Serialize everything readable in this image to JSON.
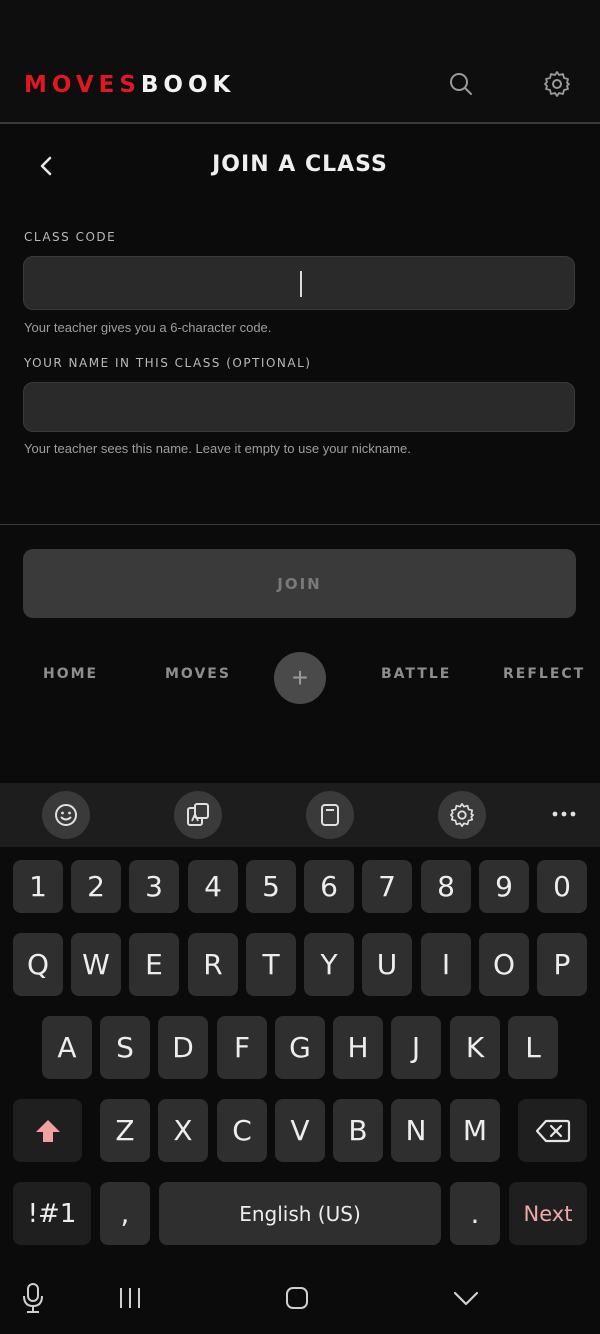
{
  "app": {
    "logo_red": "MOVES",
    "logo_white": "BOOK"
  },
  "page": {
    "title": "JOIN A CLASS"
  },
  "form": {
    "class_code_label": "CLASS CODE",
    "class_code_value": "",
    "class_code_hint": "Your teacher gives you a 6-character code.",
    "name_label": "YOUR NAME IN THIS CLASS (OPTIONAL)",
    "name_value": "",
    "name_hint": "Your teacher sees this name. Leave it empty to use your nickname.",
    "join_label": "JOIN"
  },
  "tabs": [
    "HOME",
    "MOVES",
    "BATTLE",
    "REFLECT"
  ],
  "fab_label": "+",
  "keyboard": {
    "row_numbers": [
      "1",
      "2",
      "3",
      "4",
      "5",
      "6",
      "7",
      "8",
      "9",
      "0"
    ],
    "row1": [
      "Q",
      "W",
      "E",
      "R",
      "T",
      "Y",
      "U",
      "I",
      "O",
      "P"
    ],
    "row2": [
      "A",
      "S",
      "D",
      "F",
      "G",
      "H",
      "J",
      "K",
      "L"
    ],
    "row3": [
      "Z",
      "X",
      "C",
      "V",
      "B",
      "N",
      "M"
    ],
    "symbols": "!#1",
    "comma": ",",
    "space": "English (US)",
    "period": ".",
    "next": "Next"
  },
  "colors": {
    "brand_red": "#e0181f",
    "next_text": "#f0a8a8",
    "shift_icon": "#f2a0a0"
  }
}
